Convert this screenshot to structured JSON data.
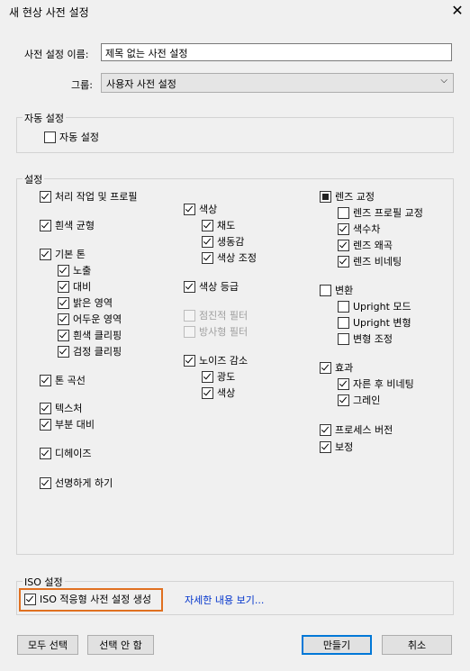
{
  "window": {
    "title": "새 현상 사전 설정",
    "close_glyph": "✕"
  },
  "preset_name": {
    "label": "사전 설정 이름:",
    "value": "제목 없는 사전 설정"
  },
  "group": {
    "label": "그룹:",
    "value": "사용자 사전 설정",
    "chevron": "⌵"
  },
  "auto_settings": {
    "title": "자동 설정",
    "checkbox": {
      "label": "자동 설정",
      "checked": false
    }
  },
  "settings": {
    "title": "설정",
    "col1": [
      {
        "label": "처리 작업 및 프로필",
        "state": "checked"
      },
      {
        "label": "흰색 균형",
        "state": "checked"
      },
      {
        "label": "기본 톤",
        "state": "checked"
      },
      {
        "label": "노출",
        "state": "checked"
      },
      {
        "label": "대비",
        "state": "checked"
      },
      {
        "label": "밝은 영역",
        "state": "checked"
      },
      {
        "label": "어두운 영역",
        "state": "checked"
      },
      {
        "label": "흰색 클리핑",
        "state": "checked"
      },
      {
        "label": "검정 클리핑",
        "state": "checked"
      },
      {
        "label": "톤 곡선",
        "state": "checked"
      },
      {
        "label": "텍스처",
        "state": "checked"
      },
      {
        "label": "부분 대비",
        "state": "checked"
      },
      {
        "label": "디헤이즈",
        "state": "checked"
      },
      {
        "label": "선명하게 하기",
        "state": "checked"
      }
    ],
    "col2": [
      {
        "label": "색상",
        "state": "checked"
      },
      {
        "label": "채도",
        "state": "checked"
      },
      {
        "label": "생동감",
        "state": "checked"
      },
      {
        "label": "색상 조정",
        "state": "checked"
      },
      {
        "label": "색상 등급",
        "state": "checked"
      },
      {
        "label": "점진적 필터",
        "state": "disabled"
      },
      {
        "label": "방사형 필터",
        "state": "disabled"
      },
      {
        "label": "노이즈 감소",
        "state": "checked"
      },
      {
        "label": "광도",
        "state": "checked"
      },
      {
        "label": "색상",
        "state": "checked"
      }
    ],
    "col3": [
      {
        "label": "렌즈 교정",
        "state": "filled"
      },
      {
        "label": "렌즈 프로필 교정",
        "state": "unchecked"
      },
      {
        "label": "색수차",
        "state": "checked"
      },
      {
        "label": "렌즈 왜곡",
        "state": "checked"
      },
      {
        "label": "렌즈 비네팅",
        "state": "checked"
      },
      {
        "label": "변환",
        "state": "unchecked"
      },
      {
        "label": "Upright 모드",
        "state": "unchecked"
      },
      {
        "label": "Upright 변형",
        "state": "unchecked"
      },
      {
        "label": "변형 조정",
        "state": "unchecked"
      },
      {
        "label": "효과",
        "state": "checked"
      },
      {
        "label": "자른 후 비네팅",
        "state": "checked"
      },
      {
        "label": "그레인",
        "state": "checked"
      },
      {
        "label": "프로세스 버전",
        "state": "checked"
      },
      {
        "label": "보정",
        "state": "checked"
      }
    ]
  },
  "iso": {
    "title": "ISO 설정",
    "checkbox": {
      "label": "ISO 적응형 사전 설정 생성",
      "checked": true
    },
    "link": "자세한 내용 보기...",
    "highlight_color": "#e07020"
  },
  "buttons": {
    "select_all": "모두 선택",
    "select_none": "선택 안 함",
    "create": "만들기",
    "cancel": "취소"
  },
  "colors": {
    "background": "#f0f0f0",
    "link": "#0033cc",
    "primary_border": "#0078d7"
  }
}
